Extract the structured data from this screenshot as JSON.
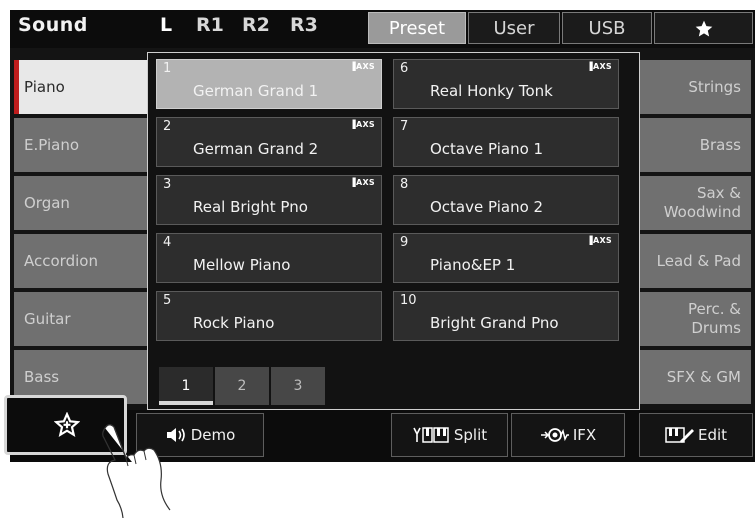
{
  "header": {
    "title": "Sound",
    "parts": [
      "L",
      "R1",
      "R2",
      "R3"
    ],
    "tabs": [
      "Preset",
      "User",
      "USB"
    ],
    "favorite_icon": "star-icon"
  },
  "left_categories": [
    "Piano",
    "E.Piano",
    "Organ",
    "Accordion",
    "Guitar",
    "Bass"
  ],
  "right_categories": [
    "Strings",
    "Brass",
    "Sax &\nWoodwind",
    "Lead & Pad",
    "Perc. &\nDrums",
    "SFX & GM"
  ],
  "voices": [
    {
      "num": "1",
      "name": "German Grand 1",
      "axs": "AXS"
    },
    {
      "num": "2",
      "name": "German Grand 2",
      "axs": "AXS"
    },
    {
      "num": "3",
      "name": "Real Bright Pno",
      "axs": "AXS"
    },
    {
      "num": "4",
      "name": "Mellow Piano",
      "axs": ""
    },
    {
      "num": "5",
      "name": "Rock Piano",
      "axs": ""
    },
    {
      "num": "6",
      "name": "Real Honky Tonk",
      "axs": "AXS"
    },
    {
      "num": "7",
      "name": "Octave Piano 1",
      "axs": ""
    },
    {
      "num": "8",
      "name": "Octave Piano 2",
      "axs": ""
    },
    {
      "num": "9",
      "name": "Piano&EP 1",
      "axs": "AXS"
    },
    {
      "num": "10",
      "name": "Bright Grand Pno",
      "axs": ""
    }
  ],
  "pages": [
    "1",
    "2",
    "3"
  ],
  "footer": {
    "demo": "Demo",
    "split": "Split",
    "ifx": "IFX",
    "edit": "Edit"
  },
  "colors": {
    "accent_red": "#bf1d1d",
    "selected_voice": "#b3b3b3",
    "screen_bg": "#141414"
  }
}
